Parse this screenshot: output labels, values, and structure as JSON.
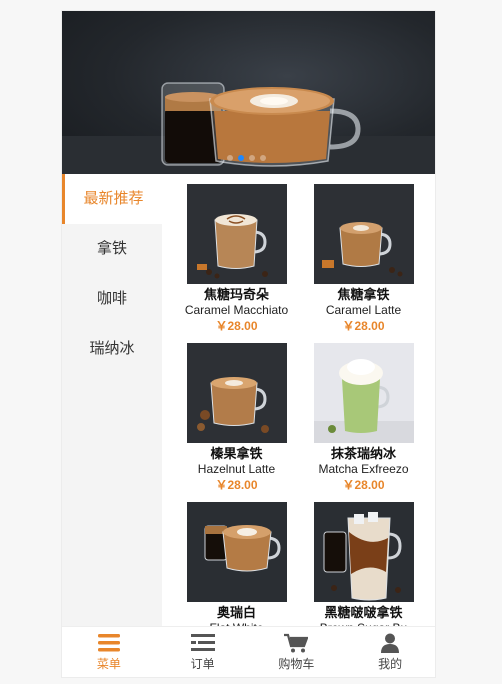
{
  "banner": {
    "slide_count": 4,
    "active_slide": 1
  },
  "categories": [
    {
      "label": "最新推荐",
      "active": true
    },
    {
      "label": "拿铁",
      "active": false
    },
    {
      "label": "咖啡",
      "active": false
    },
    {
      "label": "瑞纳冰",
      "active": false
    }
  ],
  "products": [
    {
      "name": "焦糖玛奇朵",
      "en": "Caramel Macchiato",
      "price": "￥28.00"
    },
    {
      "name": "焦糖拿铁",
      "en": "Caramel Latte",
      "price": "￥28.00"
    },
    {
      "name": "榛果拿铁",
      "en": "Hazelnut Latte",
      "price": "￥28.00"
    },
    {
      "name": "抹茶瑞纳冰",
      "en": "Matcha Exfreezo",
      "price": "￥28.00"
    },
    {
      "name": "奥瑞白",
      "en": "Flat White",
      "price": ""
    },
    {
      "name": "黑糖啵啵拿铁",
      "en": "Brown Sugar Bu",
      "price": ""
    }
  ],
  "tabbar": [
    {
      "label": "菜单",
      "icon": "menu-icon",
      "active": true
    },
    {
      "label": "订单",
      "icon": "order-list-icon",
      "active": false
    },
    {
      "label": "购物车",
      "icon": "cart-icon",
      "active": false
    },
    {
      "label": "我的",
      "icon": "user-icon",
      "active": false
    }
  ],
  "colors": {
    "accent": "#e8862b",
    "dot_active": "#1e88ff"
  }
}
